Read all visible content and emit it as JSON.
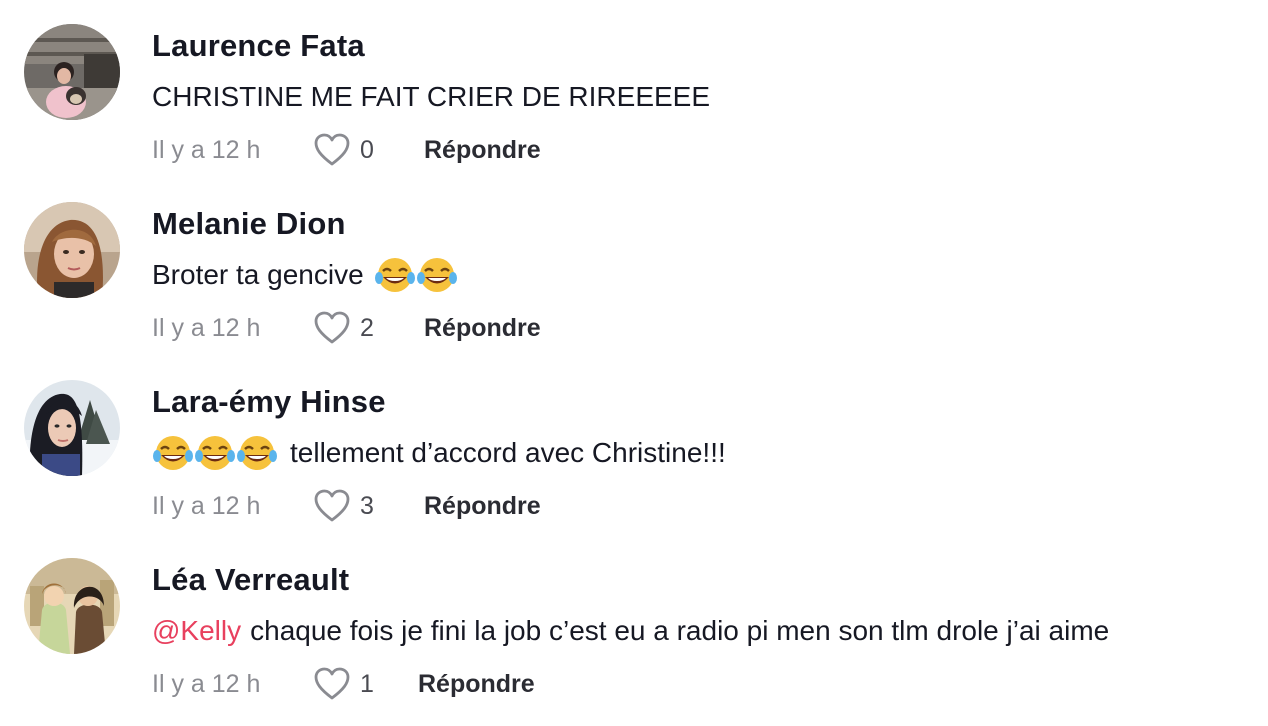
{
  "colors": {
    "mention": "#e8405e",
    "text": "#161823",
    "muted": "#8a8b91"
  },
  "comments": [
    {
      "username": "Laurence Fata",
      "text": "CHRISTINE ME FAIT CRIER DE RIREEEEE",
      "time": "Il y a 12 h",
      "likes": "0",
      "reply_label": "Répondre"
    },
    {
      "username": "Melanie Dion",
      "text": "Broter ta gencive",
      "emoji_after": [
        "face-with-tears-of-joy",
        "face-with-tears-of-joy"
      ],
      "time": "Il y a 12 h",
      "likes": "2",
      "reply_label": "Répondre"
    },
    {
      "username": "Lara-émy Hinse",
      "emoji_before": [
        "face-with-tears-of-joy",
        "face-with-tears-of-joy",
        "face-with-tears-of-joy"
      ],
      "text": "tellement d’accord avec Christine!!!",
      "time": "Il y a 12 h",
      "likes": "3",
      "reply_label": "Répondre"
    },
    {
      "username": "Léa Verreault",
      "mention": "@Kelly",
      "text": "chaque fois je fini la job c’est eu a radio pi men son tlm drole j’ai aime",
      "time": "Il y a 12 h",
      "likes": "1",
      "reply_label": "Répondre"
    }
  ]
}
